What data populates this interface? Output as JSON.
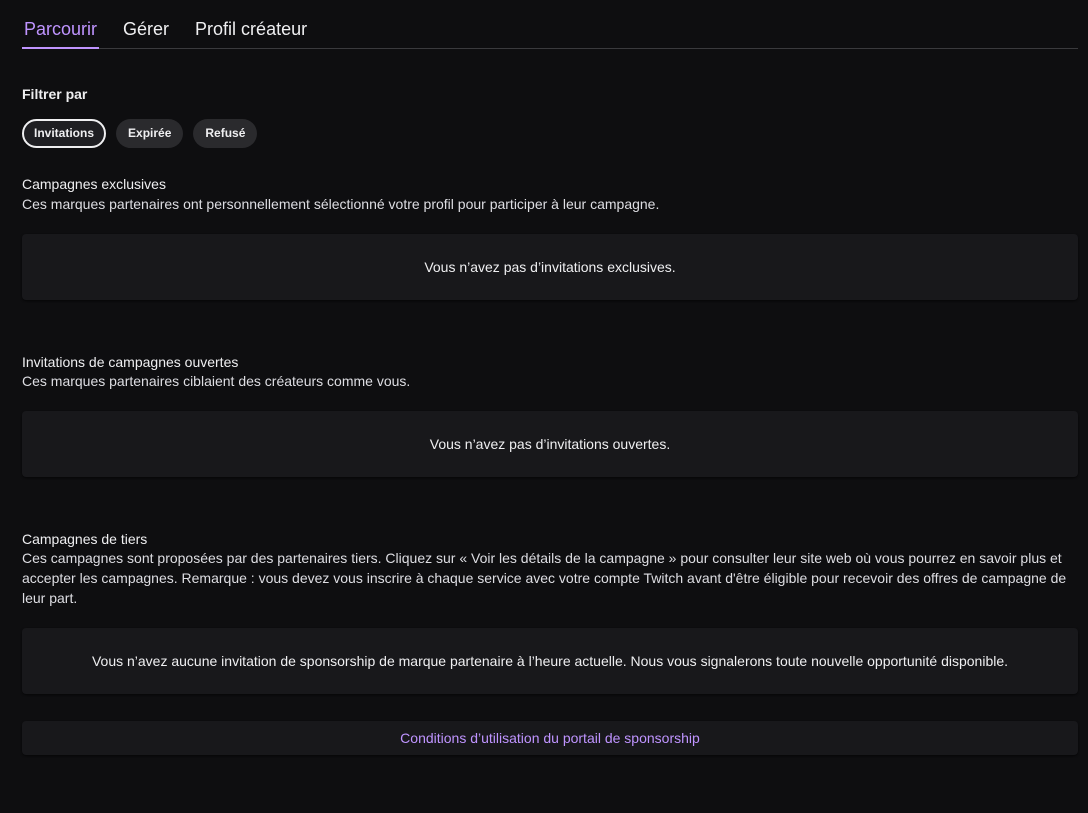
{
  "tabs": [
    {
      "label": "Parcourir",
      "active": true
    },
    {
      "label": "Gérer",
      "active": false
    },
    {
      "label": "Profil créateur",
      "active": false
    }
  ],
  "filter": {
    "label": "Filtrer par",
    "chips": [
      {
        "label": "Invitations",
        "active": true
      },
      {
        "label": "Expirée",
        "active": false
      },
      {
        "label": "Refusé",
        "active": false
      }
    ]
  },
  "sections": {
    "exclusive": {
      "title": "Campagnes exclusives",
      "description": "Ces marques partenaires ont personnellement sélectionné votre profil pour participer à leur campagne.",
      "empty": "Vous n’avez pas d’invitations exclusives."
    },
    "open": {
      "title": "Invitations de campagnes ouvertes",
      "description": "Ces marques partenaires ciblaient des créateurs comme vous.",
      "empty": "Vous n’avez pas d’invitations ouvertes."
    },
    "third_party": {
      "title": "Campagnes de tiers",
      "description": "Ces campagnes sont proposées par des partenaires tiers. Cliquez sur « Voir les détails de la campagne » pour consulter leur site web où vous pourrez en savoir plus et accepter les campagnes. Remarque : vous devez vous inscrire à chaque service avec votre compte Twitch avant d'être éligible pour recevoir des offres de campagne de leur part.",
      "empty": "Vous n’avez aucune invitation de sponsorship de marque partenaire à l’heure actuelle. Nous vous signalerons toute nouvelle opportunité disponible."
    }
  },
  "footer": {
    "terms_link": "Conditions d’utilisation du portail de sponsorship"
  },
  "colors": {
    "background": "#0e0e10",
    "card": "#18181b",
    "accent": "#bf94ff",
    "text": "#efeff1"
  }
}
